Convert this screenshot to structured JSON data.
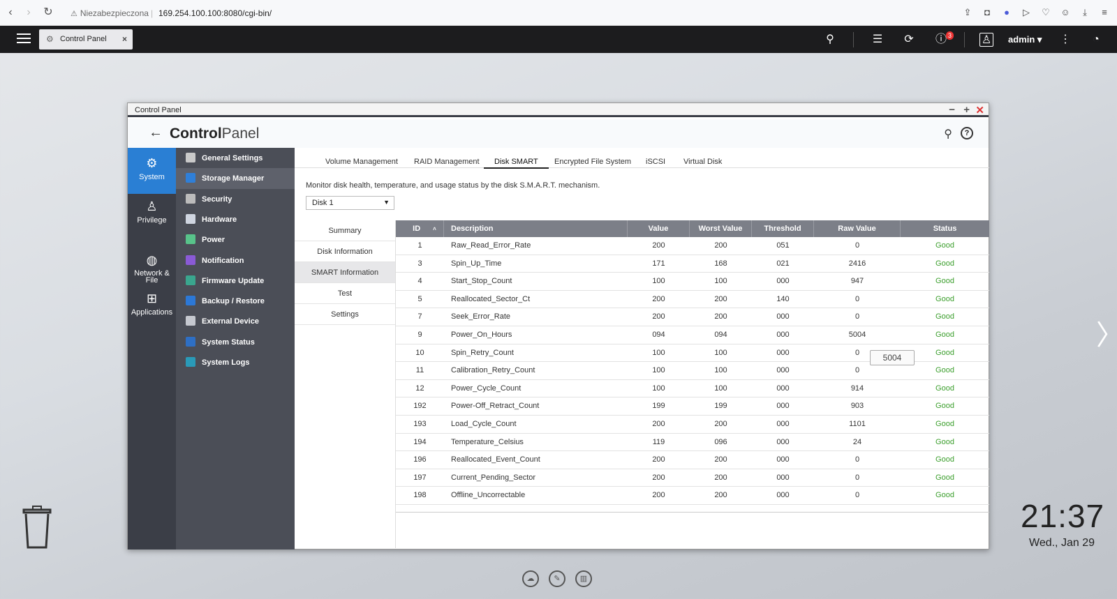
{
  "browser": {
    "insecure_label": "Niezabezpieczona",
    "url": "169.254.100.100:8080/cgi-bin/"
  },
  "qts": {
    "tab_label": "Control Panel",
    "notif_count": "3",
    "user": "admin"
  },
  "window": {
    "title": "Control Panel",
    "header_bold": "Control",
    "header_rest": "Panel"
  },
  "rail": [
    {
      "label": "System",
      "icon": "gear-icon"
    },
    {
      "label": "Privilege",
      "icon": "user-icon"
    },
    {
      "label": "Network &\nFile",
      "icon": "globe-icon"
    },
    {
      "label": "Applications",
      "icon": "apps-icon"
    }
  ],
  "submenu": [
    {
      "label": "General Settings",
      "color": "#c9c9c9"
    },
    {
      "label": "Storage Manager",
      "color": "#2f7fd8"
    },
    {
      "label": "Security",
      "color": "#bbbbbb"
    },
    {
      "label": "Hardware",
      "color": "#cfd5e0"
    },
    {
      "label": "Power",
      "color": "#58c38a"
    },
    {
      "label": "Notification",
      "color": "#8a5ad6"
    },
    {
      "label": "Firmware Update",
      "color": "#3aa68e"
    },
    {
      "label": "Backup / Restore",
      "color": "#2c78d6"
    },
    {
      "label": "External Device",
      "color": "#c5c8cf"
    },
    {
      "label": "System Status",
      "color": "#2e6fc4"
    },
    {
      "label": "System Logs",
      "color": "#2a9ab8"
    }
  ],
  "tabs": [
    "Volume Management",
    "RAID Management",
    "Disk SMART",
    "Encrypted File System",
    "iSCSI",
    "Virtual Disk"
  ],
  "description": "Monitor disk health, temperature, and usage status by the disk S.M.A.R.T. mechanism.",
  "disk_select": "Disk 1",
  "side_menu": [
    "Summary",
    "Disk Information",
    "SMART Information",
    "Test",
    "Settings"
  ],
  "table": {
    "headers": [
      "ID",
      "Description",
      "Value",
      "Worst Value",
      "Threshold",
      "Raw Value",
      "Status"
    ],
    "rows": [
      [
        "1",
        "Raw_Read_Error_Rate",
        "200",
        "200",
        "051",
        "0",
        "Good"
      ],
      [
        "3",
        "Spin_Up_Time",
        "171",
        "168",
        "021",
        "2416",
        "Good"
      ],
      [
        "4",
        "Start_Stop_Count",
        "100",
        "100",
        "000",
        "947",
        "Good"
      ],
      [
        "5",
        "Reallocated_Sector_Ct",
        "200",
        "200",
        "140",
        "0",
        "Good"
      ],
      [
        "7",
        "Seek_Error_Rate",
        "200",
        "200",
        "000",
        "0",
        "Good"
      ],
      [
        "9",
        "Power_On_Hours",
        "094",
        "094",
        "000",
        "5004",
        "Good"
      ],
      [
        "10",
        "Spin_Retry_Count",
        "100",
        "100",
        "000",
        "0",
        "Good"
      ],
      [
        "11",
        "Calibration_Retry_Count",
        "100",
        "100",
        "000",
        "0",
        "Good"
      ],
      [
        "12",
        "Power_Cycle_Count",
        "100",
        "100",
        "000",
        "914",
        "Good"
      ],
      [
        "192",
        "Power-Off_Retract_Count",
        "199",
        "199",
        "000",
        "903",
        "Good"
      ],
      [
        "193",
        "Load_Cycle_Count",
        "200",
        "200",
        "000",
        "1101",
        "Good"
      ],
      [
        "194",
        "Temperature_Celsius",
        "119",
        "096",
        "000",
        "24",
        "Good"
      ],
      [
        "196",
        "Reallocated_Event_Count",
        "200",
        "200",
        "000",
        "0",
        "Good"
      ],
      [
        "197",
        "Current_Pending_Sector",
        "200",
        "200",
        "000",
        "0",
        "Good"
      ],
      [
        "198",
        "Offline_Uncorrectable",
        "200",
        "200",
        "000",
        "0",
        "Good"
      ]
    ],
    "tooltip": "5004"
  },
  "clock": {
    "time": "21:37",
    "date": "Wed., Jan 29"
  }
}
